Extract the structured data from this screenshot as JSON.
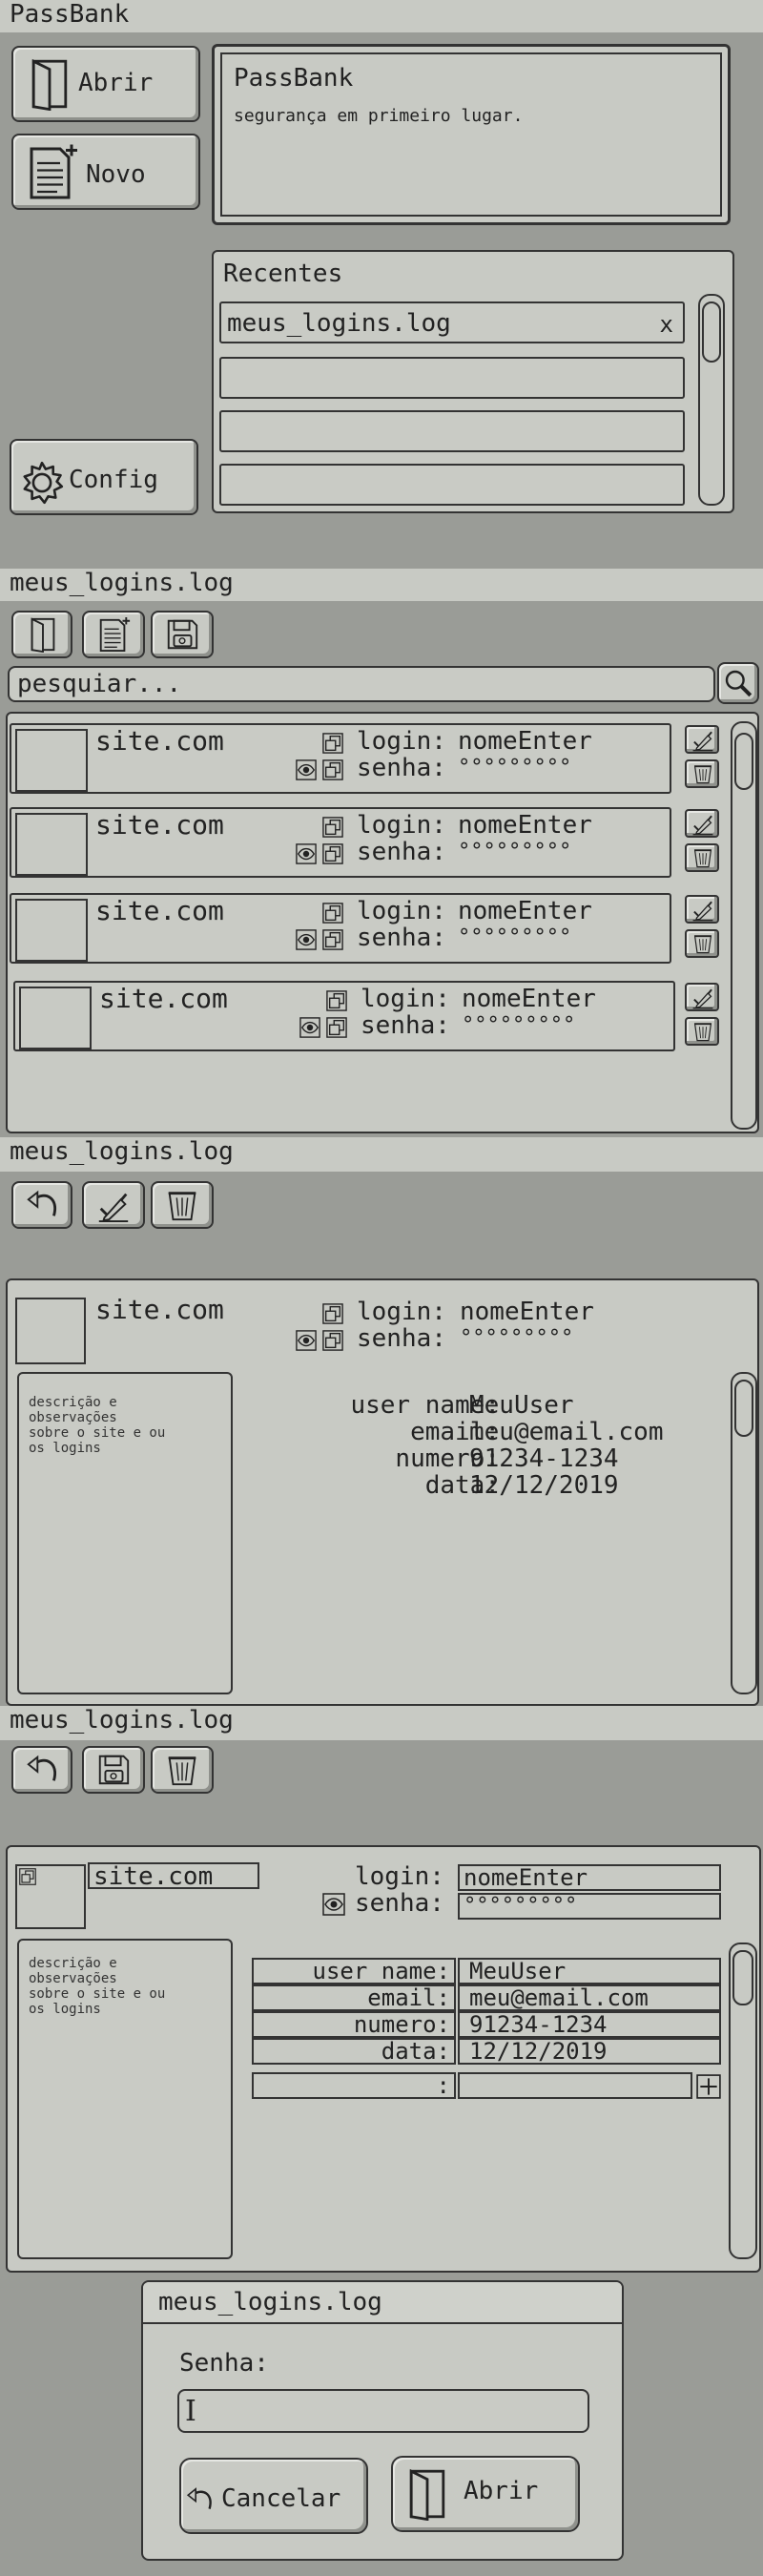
{
  "app_title": "PassBank",
  "home": {
    "open_label": "Abrir",
    "new_label": "Novo",
    "config_label": "Config",
    "header_title": "PassBank",
    "header_subtitle": "segurança em primeiro lugar.",
    "recents_title": "Recentes",
    "recent_files": [
      "meus_logins.log",
      "",
      "",
      ""
    ],
    "remove_glyph": "x"
  },
  "list_view": {
    "file_title": "meus_logins.log",
    "search_placeholder": "pesquiar...",
    "entries": [
      {
        "site": "site.com",
        "login_label": "login:",
        "login_value": "nomeEnter",
        "password_label": "senha:",
        "password_value": "°°°°°°°°°"
      },
      {
        "site": "site.com",
        "login_label": "login:",
        "login_value": "nomeEnter",
        "password_label": "senha:",
        "password_value": "°°°°°°°°°"
      },
      {
        "site": "site.com",
        "login_label": "login:",
        "login_value": "nomeEnter",
        "password_label": "senha:",
        "password_value": "°°°°°°°°°"
      },
      {
        "site": "site.com",
        "login_label": "login:",
        "login_value": "nomeEnter",
        "password_label": "senha:",
        "password_value": "°°°°°°°°°"
      }
    ]
  },
  "detail_view": {
    "file_title": "meus_logins.log",
    "site": "site.com",
    "login_label": "login:",
    "login_value": "nomeEnter",
    "password_label": "senha:",
    "password_value": "°°°°°°°°°",
    "description": "descrição e\nobservações\nsobre o site e ou\nos logins",
    "fields": [
      {
        "label": "user name:",
        "value": "MeuUser"
      },
      {
        "label": "email:",
        "value": "meu@email.com"
      },
      {
        "label": "numero:",
        "value": "91234-1234"
      },
      {
        "label": "data:",
        "value": "12/12/2019"
      }
    ]
  },
  "edit_view": {
    "file_title": "meus_logins.log",
    "site": "site.com",
    "login_label": "login:",
    "login_value": "nomeEnter",
    "password_label": "senha:",
    "password_value": "°°°°°°°°°",
    "description": "descrição e\nobservações\nsobre o site e ou\nos logins",
    "fields": [
      {
        "label": "user name:",
        "value": "MeuUser"
      },
      {
        "label": "email:",
        "value": "meu@email.com"
      },
      {
        "label": "numero:",
        "value": "91234-1234"
      },
      {
        "label": "data:",
        "value": "12/12/2019"
      }
    ],
    "new_field_label": ":",
    "add_glyph": "+"
  },
  "password_dialog": {
    "title": "meus_logins.log",
    "password_label": "Senha:",
    "password_value": "",
    "cancel_label": "Cancelar",
    "open_label": "Abrir"
  },
  "icons": {
    "open": "door-icon",
    "new": "new-document-icon",
    "config": "gear-icon",
    "save": "floppy-disk-icon",
    "back": "undo-arrow-icon",
    "edit": "pen-check-icon",
    "delete": "trash-icon",
    "search": "magnifier-icon",
    "show": "eye-icon",
    "copy": "copy-icon"
  },
  "colors": {
    "background": "#9a9c97",
    "surface": "#c8cac4",
    "outline": "#333333"
  }
}
